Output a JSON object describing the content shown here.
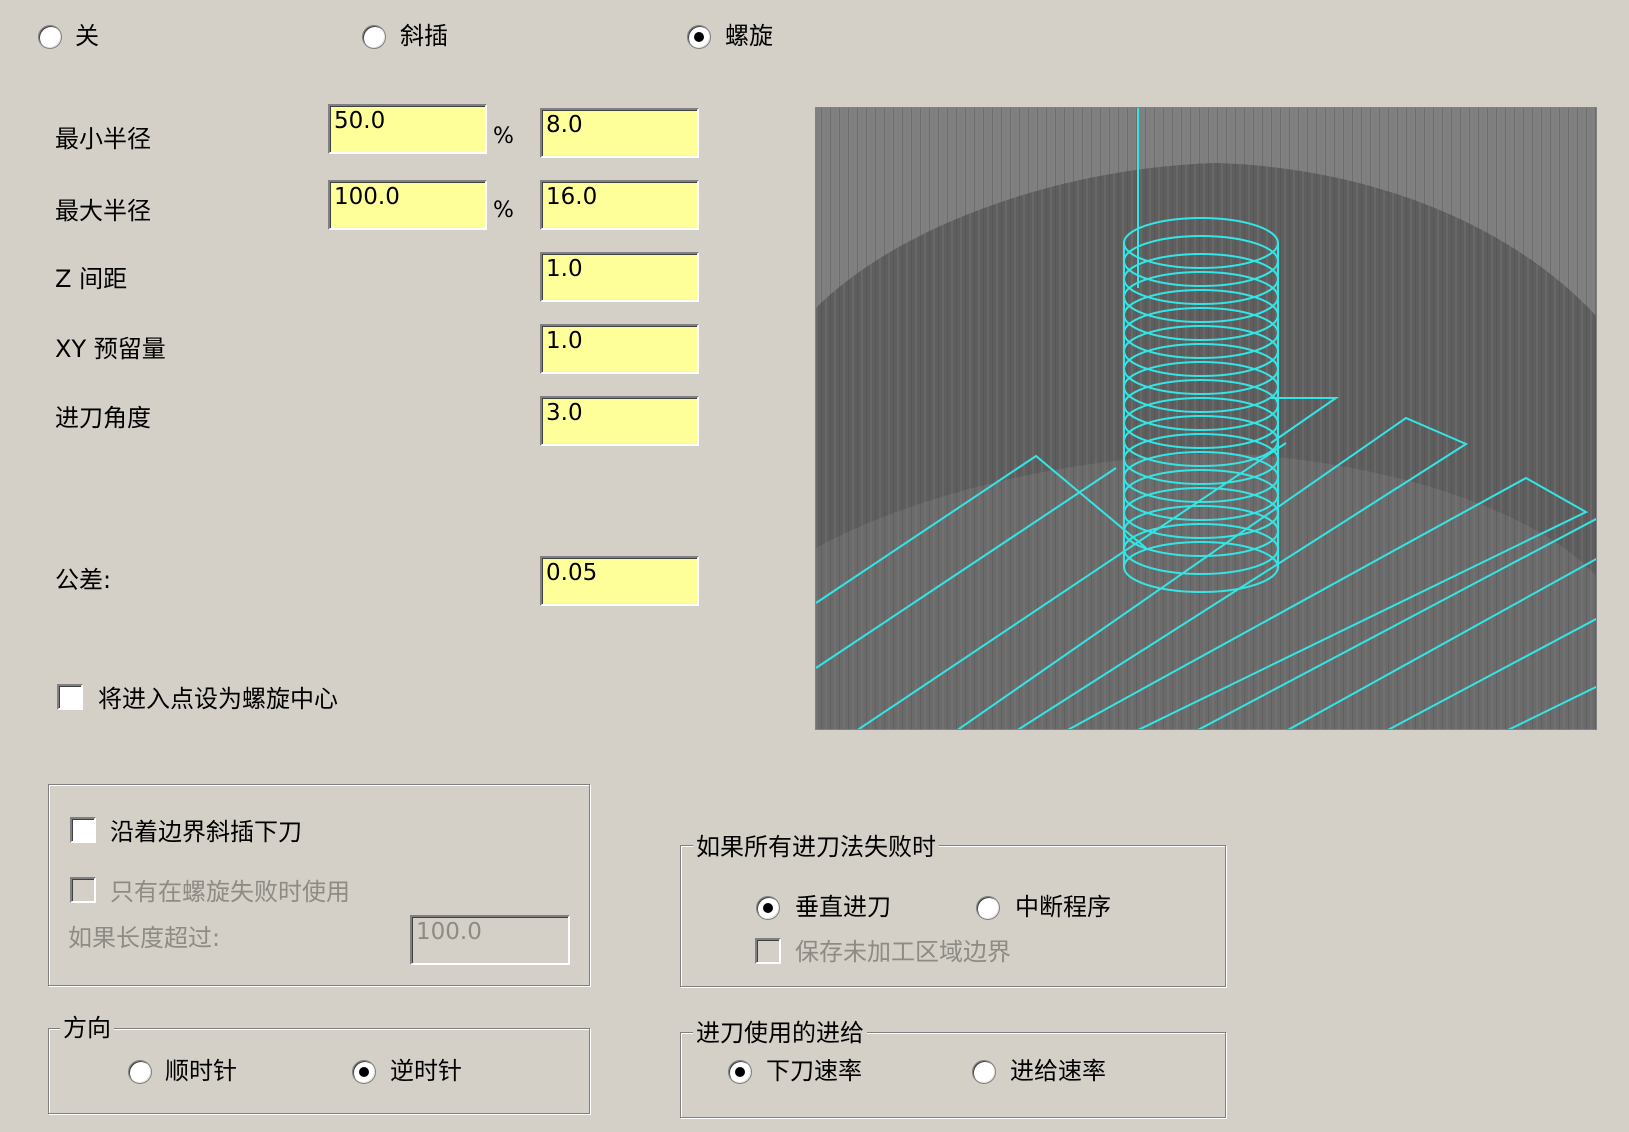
{
  "mode": {
    "off_label": "关",
    "ramp_label": "斜插",
    "helix_label": "螺旋",
    "selected": "helix"
  },
  "params": {
    "min_radius_label": "最小半径",
    "min_radius_percent": "50.0",
    "min_radius_value": "8.0",
    "max_radius_label": "最大半径",
    "max_radius_percent": "100.0",
    "max_radius_value": "16.0",
    "percent_sign": "%",
    "z_step_label": "Z 间距",
    "z_step_value": "1.0",
    "xy_allowance_label": "XY 预留量",
    "xy_allowance_value": "1.0",
    "entry_angle_label": "进刀角度",
    "entry_angle_value": "3.0",
    "tolerance_label": "公差:",
    "tolerance_value": "0.05"
  },
  "center_option": {
    "label": "将进入点设为螺旋中心",
    "checked": false
  },
  "boundary_group": {
    "ramp_along_boundary_label": "沿着边界斜插下刀",
    "only_if_helix_fails_label": "只有在螺旋失败时使用",
    "if_length_exceeds_label": "如果长度超过:",
    "length_value": "100.0"
  },
  "fail_group": {
    "title": "如果所有进刀法失败时",
    "vertical_plunge_label": "垂直进刀",
    "abort_program_label": "中断程序",
    "save_boundary_label": "保存未加工区域边界",
    "selected": "vertical_plunge"
  },
  "direction_group": {
    "title": "方向",
    "clockwise_label": "顺时针",
    "counterclockwise_label": "逆时针",
    "selected": "counterclockwise"
  },
  "feed_group": {
    "title": "进刀使用的进给",
    "plunge_rate_label": "下刀速率",
    "feed_rate_label": "进给速率",
    "selected": "plunge_rate"
  },
  "colors": {
    "background": "#d4d0c8",
    "field_yellow": "#ffff99",
    "toolpath_cyan": "#33e6e6"
  }
}
